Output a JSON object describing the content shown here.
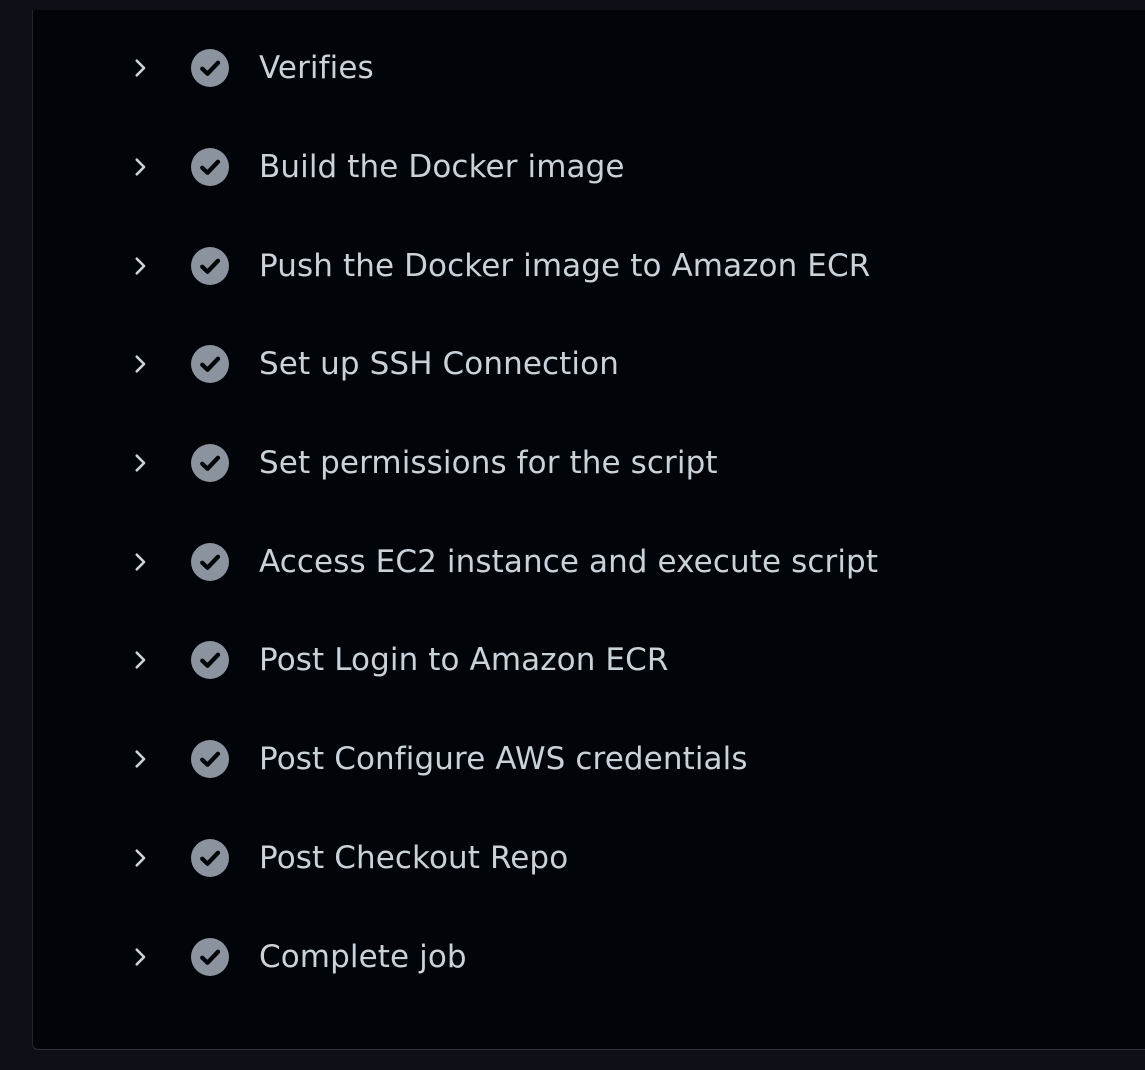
{
  "job": {
    "steps": [
      {
        "label": "Verifies",
        "status": "success",
        "expand_icon": "chevron-right-icon",
        "status_icon": "check-circle-icon"
      },
      {
        "label": "Build the Docker image",
        "status": "success",
        "expand_icon": "chevron-right-icon",
        "status_icon": "check-circle-icon"
      },
      {
        "label": "Push the Docker image to Amazon ECR",
        "status": "success",
        "expand_icon": "chevron-right-icon",
        "status_icon": "check-circle-icon"
      },
      {
        "label": "Set up SSH Connection",
        "status": "success",
        "expand_icon": "chevron-right-icon",
        "status_icon": "check-circle-icon"
      },
      {
        "label": "Set permissions for the script",
        "status": "success",
        "expand_icon": "chevron-right-icon",
        "status_icon": "check-circle-icon"
      },
      {
        "label": "Access EC2 instance and execute script",
        "status": "success",
        "expand_icon": "chevron-right-icon",
        "status_icon": "check-circle-icon"
      },
      {
        "label": "Post Login to Amazon ECR",
        "status": "success",
        "expand_icon": "chevron-right-icon",
        "status_icon": "check-circle-icon"
      },
      {
        "label": "Post Configure AWS credentials",
        "status": "success",
        "expand_icon": "chevron-right-icon",
        "status_icon": "check-circle-icon"
      },
      {
        "label": "Post Checkout Repo",
        "status": "success",
        "expand_icon": "chevron-right-icon",
        "status_icon": "check-circle-icon"
      },
      {
        "label": "Complete job",
        "status": "success",
        "expand_icon": "chevron-right-icon",
        "status_icon": "check-circle-icon"
      }
    ]
  },
  "colors": {
    "page_background": "#0d1117",
    "panel_background": "#010409",
    "text": "#c9d1d9",
    "icon": "#8b949e",
    "check_mark": "#010409"
  }
}
